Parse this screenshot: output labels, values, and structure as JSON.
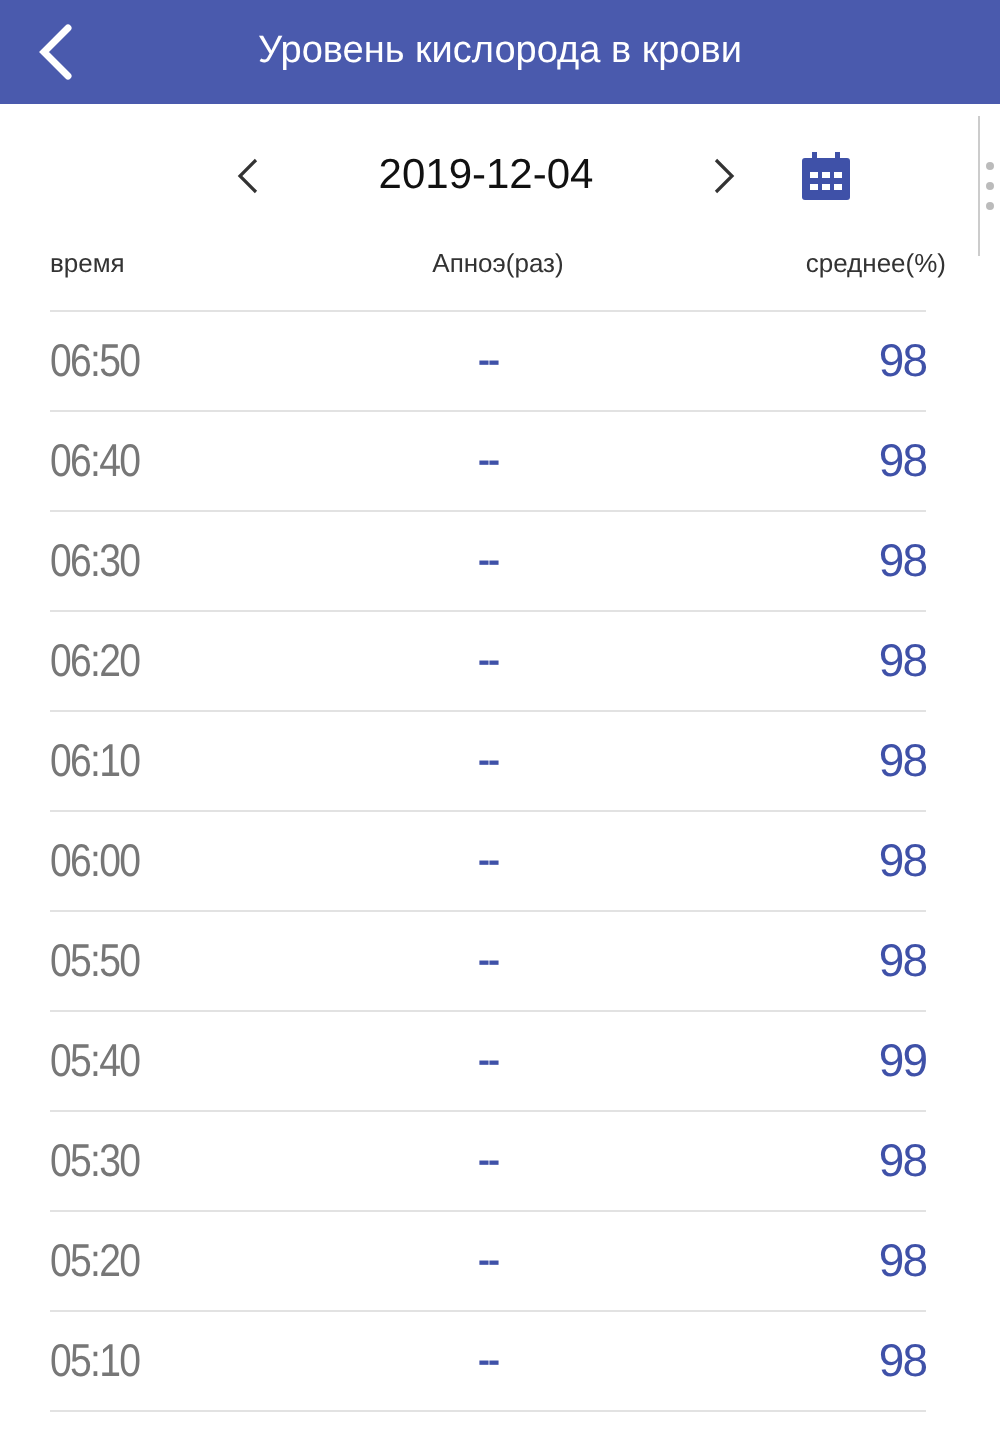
{
  "header": {
    "title": "Уровень кислорода в крови"
  },
  "date_nav": {
    "date": "2019-12-04"
  },
  "table": {
    "columns": [
      "время",
      "Апноэ(раз)",
      "среднее(%)"
    ],
    "rows": [
      {
        "time": "06:50",
        "apnea": "--",
        "average": "98"
      },
      {
        "time": "06:40",
        "apnea": "--",
        "average": "98"
      },
      {
        "time": "06:30",
        "apnea": "--",
        "average": "98"
      },
      {
        "time": "06:20",
        "apnea": "--",
        "average": "98"
      },
      {
        "time": "06:10",
        "apnea": "--",
        "average": "98"
      },
      {
        "time": "06:00",
        "apnea": "--",
        "average": "98"
      },
      {
        "time": "05:50",
        "apnea": "--",
        "average": "98"
      },
      {
        "time": "05:40",
        "apnea": "--",
        "average": "99"
      },
      {
        "time": "05:30",
        "apnea": "--",
        "average": "98"
      },
      {
        "time": "05:20",
        "apnea": "--",
        "average": "98"
      },
      {
        "time": "05:10",
        "apnea": "--",
        "average": "98"
      }
    ]
  }
}
